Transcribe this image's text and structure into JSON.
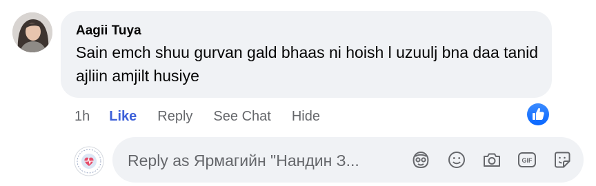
{
  "comment": {
    "author": "Aagii Tuya",
    "text": "Sain emch shuu gurvan gald bhaas ni hoish l uzuulj bna daa tanid ajliin amjilt husiye",
    "time": "1h",
    "actions": {
      "like": "Like",
      "reply": "Reply",
      "see_chat": "See Chat",
      "hide": "Hide"
    },
    "reaction": "like-icon"
  },
  "reply_composer": {
    "placeholder": "Reply as Ярмагийн \"Нандин З...",
    "tools": [
      "sticker-icon",
      "emoji-icon",
      "camera-icon",
      "gif-icon",
      "sticker-note-icon"
    ]
  },
  "colors": {
    "bubble": "#f0f2f5",
    "link_blue": "#3b5fd9",
    "meta_gray": "#65676b",
    "reaction_blue": "#1877f2"
  }
}
